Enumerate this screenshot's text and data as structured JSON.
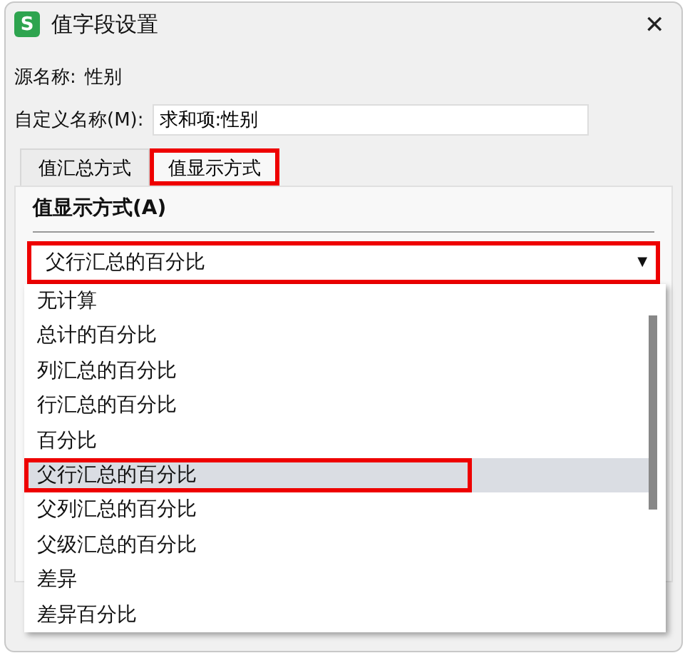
{
  "window": {
    "title": "值字段设置",
    "logo": "S",
    "close": "✕"
  },
  "source_name": {
    "label": "源名称:",
    "value": "性别"
  },
  "custom_name": {
    "label": "自定义名称(M):",
    "value": "求和项:性别"
  },
  "tabs": [
    {
      "label": "值汇总方式",
      "selected": false,
      "annotated": false
    },
    {
      "label": "值显示方式",
      "selected": true,
      "annotated": true
    }
  ],
  "section_label": "值显示方式(A)",
  "dropdown": {
    "value": "父行汇总的百分比",
    "arrow": "▼",
    "annotated": true,
    "expanded": true,
    "options": [
      {
        "label": "无计算",
        "selected": false,
        "annotated": false
      },
      {
        "label": "总计的百分比",
        "selected": false,
        "annotated": false
      },
      {
        "label": "列汇总的百分比",
        "selected": false,
        "annotated": false
      },
      {
        "label": "行汇总的百分比",
        "selected": false,
        "annotated": false
      },
      {
        "label": "百分比",
        "selected": false,
        "annotated": false
      },
      {
        "label": "父行汇总的百分比",
        "selected": true,
        "annotated": true
      },
      {
        "label": "父列汇总的百分比",
        "selected": false,
        "annotated": false
      },
      {
        "label": "父级汇总的百分比",
        "selected": false,
        "annotated": false
      },
      {
        "label": "差异",
        "selected": false,
        "annotated": false
      },
      {
        "label": "差异百分比",
        "selected": false,
        "annotated": false
      }
    ]
  }
}
